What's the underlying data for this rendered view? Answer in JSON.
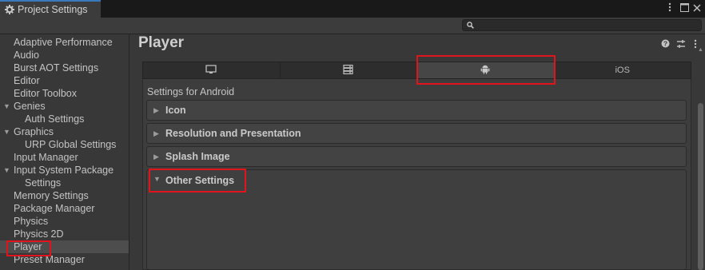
{
  "window": {
    "tab_title": "Project Settings",
    "controls": [
      "menu-icon",
      "maximize-icon",
      "close-icon"
    ]
  },
  "search": {
    "placeholder": ""
  },
  "sidebar": {
    "items": [
      {
        "label": "Adaptive Performance",
        "indent": 0,
        "expandable": false
      },
      {
        "label": "Audio",
        "indent": 0,
        "expandable": false
      },
      {
        "label": "Burst AOT Settings",
        "indent": 0,
        "expandable": false
      },
      {
        "label": "Editor",
        "indent": 0,
        "expandable": false
      },
      {
        "label": "Editor Toolbox",
        "indent": 0,
        "expandable": false
      },
      {
        "label": "Genies",
        "indent": 0,
        "expandable": true
      },
      {
        "label": "Auth Settings",
        "indent": 1,
        "expandable": false
      },
      {
        "label": "Graphics",
        "indent": 0,
        "expandable": true
      },
      {
        "label": "URP Global Settings",
        "indent": 1,
        "expandable": false
      },
      {
        "label": "Input Manager",
        "indent": 0,
        "expandable": false
      },
      {
        "label": "Input System Package",
        "indent": 0,
        "expandable": true
      },
      {
        "label": "Settings",
        "indent": 1,
        "expandable": false
      },
      {
        "label": "Memory Settings",
        "indent": 0,
        "expandable": false
      },
      {
        "label": "Package Manager",
        "indent": 0,
        "expandable": false
      },
      {
        "label": "Physics",
        "indent": 0,
        "expandable": false
      },
      {
        "label": "Physics 2D",
        "indent": 0,
        "expandable": false
      },
      {
        "label": "Player",
        "indent": 0,
        "expandable": false,
        "selected": true
      },
      {
        "label": "Preset Manager",
        "indent": 0,
        "expandable": false
      }
    ]
  },
  "main": {
    "title": "Player",
    "header_icons": [
      "help-icon",
      "preset-icon",
      "more-icon"
    ],
    "platform_tabs": [
      {
        "icon": "desktop-icon",
        "label": ""
      },
      {
        "icon": "server-icon",
        "label": ""
      },
      {
        "icon": "android-icon",
        "label": "",
        "active": true
      },
      {
        "icon": "",
        "label": "iOS"
      }
    ],
    "settings_for": "Settings for Android",
    "sections": [
      {
        "label": "Icon",
        "expanded": false
      },
      {
        "label": "Resolution and Presentation",
        "expanded": false
      },
      {
        "label": "Splash Image",
        "expanded": false
      },
      {
        "label": "Other Settings",
        "expanded": true
      }
    ]
  },
  "colors": {
    "highlight": "#e0141a",
    "tab_accent": "#3a79bb"
  }
}
